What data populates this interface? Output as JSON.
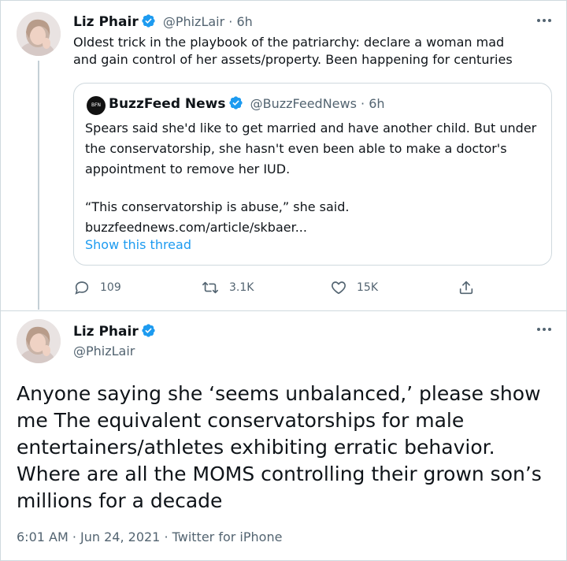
{
  "reply_tweet": {
    "author_name": "Liz Phair",
    "handle": "@PhizLair",
    "separator": "·",
    "time": "6h",
    "text": "Oldest trick in the playbook of the patriarchy: declare a woman mad and gain control of her assets/property. Been happening for centuries",
    "avatar_icon": "person-avatar-icon",
    "verified_icon": "verified-badge-icon",
    "more_icon": "more-options-icon"
  },
  "quoted_tweet": {
    "author_name": "BuzzFeed News",
    "handle": "@BuzzFeedNews",
    "separator": "·",
    "time": "6h",
    "paragraph_1": "Spears said she'd like to get married and have another child. But under the conservatorship, she hasn't even been able to make a doctor's appointment to remove her IUD.",
    "paragraph_2": "“This conservatorship is abuse,” she said.",
    "link_text": "buzzfeednews.com/article/skbaer...",
    "show_thread": "Show this thread"
  },
  "actions": {
    "reply_count": "109",
    "retweet_count": "3.1K",
    "like_count": "15K",
    "icons": [
      "reply-icon",
      "retweet-icon",
      "like-icon",
      "share-icon"
    ]
  },
  "main_tweet": {
    "author_name": "Liz Phair",
    "handle": "@PhizLair",
    "text": "Anyone saying she ‘seems unbalanced,’ please show me The equivalent conservatorships for male entertainers/athletes exhibiting erratic behavior. Where are all the MOMS controlling their grown son’s millions for a decade",
    "footer": "6:01 AM · Jun 24, 2021 · Twitter for iPhone"
  },
  "colors": {
    "accent": "#1d9bf0",
    "text": "#0f1419",
    "muted": "#536471",
    "border": "#cfd9de"
  }
}
